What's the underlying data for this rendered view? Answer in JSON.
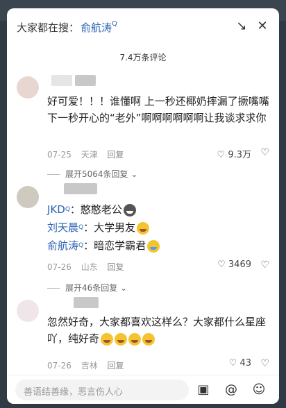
{
  "header": {
    "search_prefix": "大家都在搜：",
    "search_term": "俞航涛",
    "search_term_q": "Q",
    "collapse_icon": "↘",
    "close_icon": "✕"
  },
  "comment_count": "7.4万条评论",
  "comments": [
    {
      "text": "好可爱！！！谁懂啊 上一秒还椰奶摔漏了撅嘴嘴 下一秒开心的“老外”啊啊啊啊啊啊让我谈求求你",
      "date": "07-25",
      "location": "天津",
      "reply": "回复",
      "likes": "9.3万",
      "expand": "展开5064条回复"
    },
    {
      "line1_name": "JKD",
      "line1_q": "Q",
      "line1_text": "：憨憨老公",
      "line2_name": "刘天晨",
      "line2_q": "Q",
      "line2_text": "：大学男友",
      "line3_name": "俞航涛",
      "line3_q": "Q",
      "line3_text": "：暗恋学霸君",
      "date": "07-26",
      "location": "山东",
      "reply": "回复",
      "likes": "3469",
      "expand": "展开46条回复"
    },
    {
      "text": "忽然好奇，大家都喜欢这样么？大家都什么星座吖，纯好奇",
      "date": "07-26",
      "location": "吉林",
      "reply": "回复",
      "likes": "43"
    }
  ],
  "input": {
    "placeholder": "善语结善缘，恶言伤人心"
  }
}
